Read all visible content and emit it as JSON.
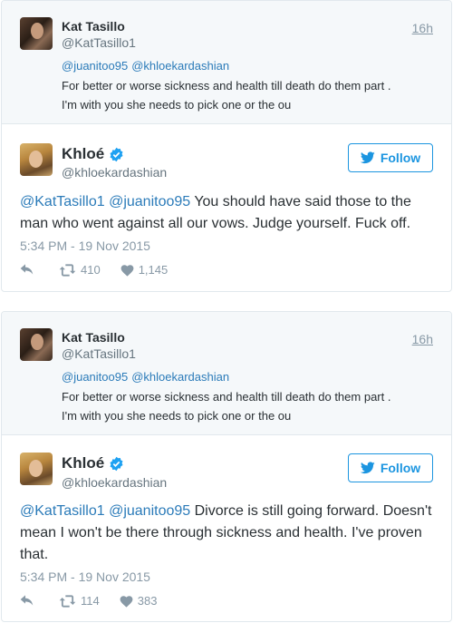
{
  "colors": {
    "link": "#2b7bb9",
    "follow": "#1b95e0",
    "muted": "#8899a6",
    "verified": "#1da1f2"
  },
  "tweets": [
    {
      "context": {
        "name": "Kat Tasillo",
        "handle": "@KatTasillo1",
        "time": "16h",
        "mentions": [
          "@juanitoo95",
          "@khloekardashian"
        ],
        "text_line1": "For better or worse sickness and health till death do them part .",
        "text_line2": "I'm with you she needs to pick one or the ou"
      },
      "author": {
        "name": "Khloé",
        "handle": "@khloekardashian",
        "follow_label": "Follow",
        "verified_icon": "verified-badge-icon"
      },
      "mentions": [
        "@KatTasillo1",
        "@juanitoo95"
      ],
      "body": "You should have said those to the man who went against all our vows. Judge yourself. Fuck off.",
      "timestamp": "5:34 PM - 19 Nov 2015",
      "retweets": "410",
      "likes": "1,145"
    },
    {
      "context": {
        "name": "Kat Tasillo",
        "handle": "@KatTasillo1",
        "time": "16h",
        "mentions": [
          "@juanitoo95",
          "@khloekardashian"
        ],
        "text_line1": "For better or worse sickness and health till death do them part .",
        "text_line2": "I'm with you she needs to pick one or the ou"
      },
      "author": {
        "name": "Khloé",
        "handle": "@khloekardashian",
        "follow_label": "Follow",
        "verified_icon": "verified-badge-icon"
      },
      "mentions": [
        "@KatTasillo1",
        "@juanitoo95"
      ],
      "body": "Divorce is still going forward. Doesn't mean I won't be there through sickness and health. I've proven that.",
      "timestamp": "5:34 PM - 19 Nov 2015",
      "retweets": "114",
      "likes": "383"
    }
  ]
}
